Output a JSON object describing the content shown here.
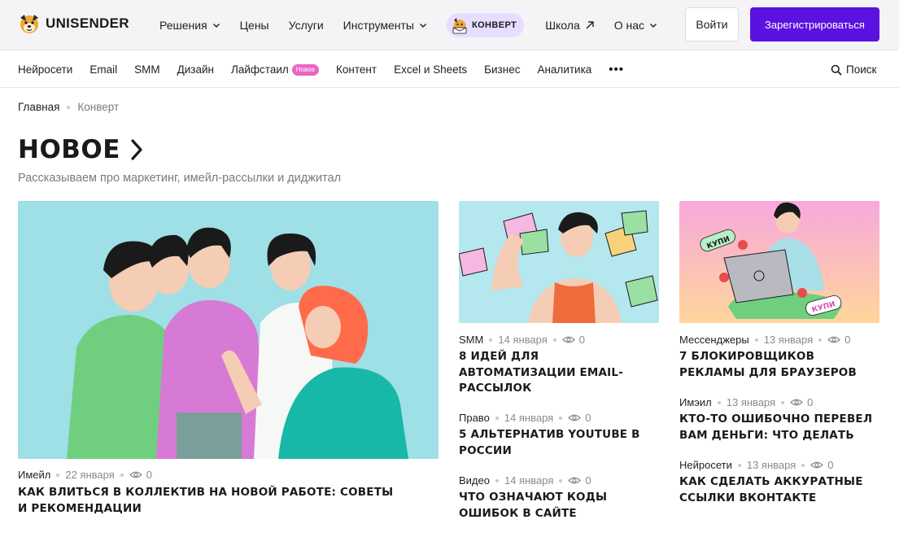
{
  "brand": {
    "name": "UNISENDER"
  },
  "nav": {
    "items": [
      {
        "label": "Решения",
        "dropdown": true
      },
      {
        "label": "Цены",
        "dropdown": false
      },
      {
        "label": "Услуги",
        "dropdown": false
      },
      {
        "label": "Инструменты",
        "dropdown": true
      }
    ],
    "konvert_label": "КОНВЕРТ",
    "school_label": "Школа",
    "about_label": "О нас"
  },
  "auth": {
    "login_label": "Войти",
    "register_label": "Зарегистрироваться"
  },
  "categories": [
    {
      "label": "Нейросети"
    },
    {
      "label": "Email"
    },
    {
      "label": "SMM"
    },
    {
      "label": "Дизайн"
    },
    {
      "label": "Лайфстаил",
      "badge": "Новое"
    },
    {
      "label": "Контент"
    },
    {
      "label": "Excel и Sheets"
    },
    {
      "label": "Бизнес"
    },
    {
      "label": "Аналитика"
    }
  ],
  "more_label": "•••",
  "search_label": "Поиск",
  "breadcrumb": {
    "home": "Главная",
    "current": "Конверт"
  },
  "heading": {
    "title": "НОВОЕ",
    "subtitle": "Рассказываем про маркетинг, имейл-рассылки и диджитал"
  },
  "articles": {
    "hero": {
      "category": "Имейл",
      "date": "22 января",
      "views": "0",
      "title": "КАК ВЛИТЬСЯ В КОЛЛЕКТИВ НА НОВОЙ РАБОТЕ: СОВЕТЫ И РЕКОМЕНДАЦИИ"
    },
    "col2": [
      {
        "category": "SMM",
        "date": "14 января",
        "views": "0",
        "title": "8 ИДЕЙ ДЛЯ АВТОМАТИЗАЦИИ EMAIL-РАССЫЛОК"
      },
      {
        "category": "Право",
        "date": "14 января",
        "views": "0",
        "title": "5 АЛЬТЕРНАТИВ YOUTUBE В РОССИИ"
      },
      {
        "category": "Видео",
        "date": "14 января",
        "views": "0",
        "title": "ЧТО ОЗНАЧАЮТ КОДЫ ОШИБОК В САЙТЕ"
      }
    ],
    "col3": [
      {
        "category": "Мессенджеры",
        "date": "13 января",
        "views": "0",
        "title": "7 БЛОКИРОВЩИКОВ РЕКЛАМЫ ДЛЯ БРАУЗЕРОВ"
      },
      {
        "category": "Имэил",
        "date": "13 января",
        "views": "0",
        "title": "КТО-ТО ОШИБОЧНО ПЕРЕВЕЛ ВАМ ДЕНЬГИ: ЧТО ДЕЛАТЬ"
      },
      {
        "category": "Нейросети",
        "date": "13 января",
        "views": "0",
        "title": "КАК СДЕЛАТЬ АККУРАТНЫЕ ССЫЛКИ ВКОНТАКТЕ"
      }
    ]
  },
  "illustration_labels": {
    "stamp": "КУПИ"
  },
  "colors": {
    "accent": "#5a12e0",
    "badge": "#e866c4",
    "konvert_pill": "#e7ddff"
  }
}
